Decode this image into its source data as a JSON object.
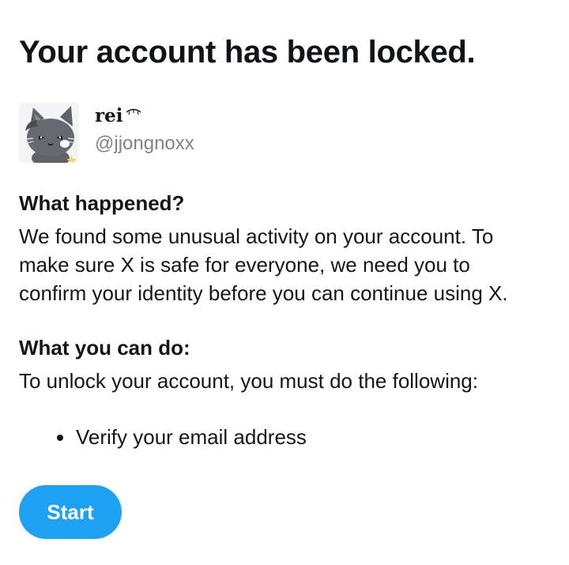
{
  "page": {
    "title": "Your account has been locked."
  },
  "profile": {
    "display_name": "rei",
    "handle": "@jjongnoxx",
    "avatar_icon": "grey-cat-avatar"
  },
  "what_happened": {
    "heading": "What happened?",
    "lines": [
      "We found some unusual activity on your account. To",
      "make sure X is safe for everyone, we need you to",
      "confirm your identity before you can continue using X."
    ]
  },
  "what_you_can_do": {
    "heading": "What you can do:",
    "body": "To unlock your account, you must do the following:",
    "steps": [
      "Verify your email address"
    ]
  },
  "actions": {
    "start_label": "Start"
  },
  "colors": {
    "accent": "#1da1f2",
    "text": "#14171a",
    "muted": "#7a8590"
  }
}
